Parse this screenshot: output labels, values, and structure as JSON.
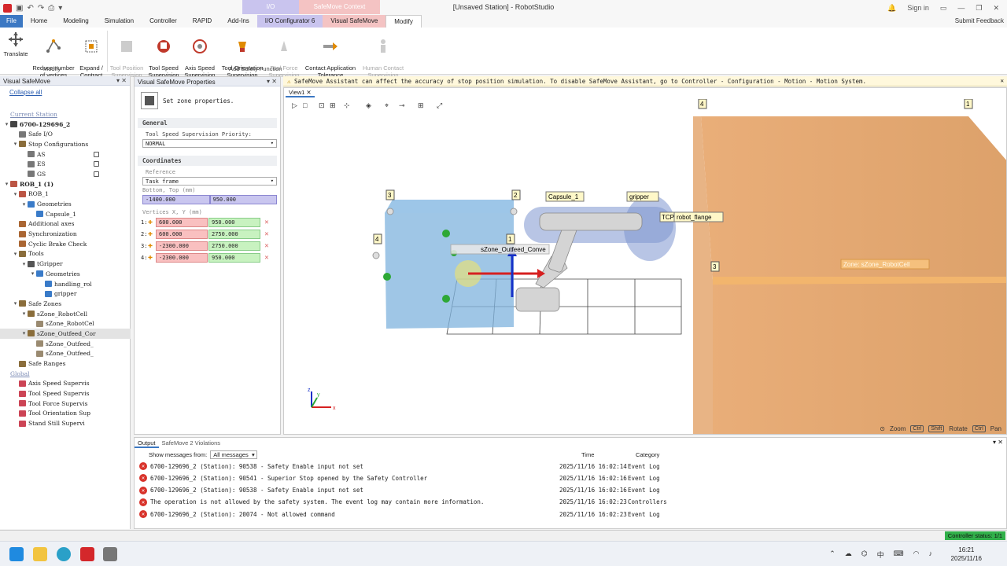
{
  "window": {
    "title": "[Unsaved Station] - RobotStudio",
    "sign_in": "Sign in",
    "context_io": "I/O",
    "context_safemove": "SafeMove Context"
  },
  "tabs": [
    "File",
    "Home",
    "Modeling",
    "Simulation",
    "Controller",
    "RAPID",
    "Add-Ins",
    "I/O Configurator 6",
    "Visual SafeMove",
    "Modify"
  ],
  "submit_feedback": "Submit Feedback",
  "ribbon": {
    "modify_group": {
      "label": "Modify",
      "translate": "Translate",
      "reduce": "Reduce number\nof vertices",
      "expand": "Expand /\nContract"
    },
    "safety_group": {
      "label": "Add Safety Function",
      "tool_position": "Tool Position\nSupervision",
      "tool_speed": "Tool Speed\nSupervision",
      "axis_speed": "Axis Speed\nSupervision",
      "tool_orientation": "Tool Orientation\nSupervision",
      "tool_force": "Tool Force\nSupervision",
      "contact_app": "Contact Application\nTolerance",
      "human_contact": "Human Contact\nSupervision"
    }
  },
  "left_panel": {
    "title": "Visual SafeMove",
    "collapse_all": "Collapse all",
    "tree": [
      {
        "label": "Current Station",
        "level": 0,
        "kind": "section"
      },
      {
        "label": "6700-129696_2",
        "level": 0,
        "kind": "controller",
        "twisty": "▾",
        "bold": true
      },
      {
        "label": "Safe I/O",
        "level": 1,
        "kind": "io"
      },
      {
        "label": "Stop Configurations",
        "level": 1,
        "kind": "folder",
        "twisty": "▾"
      },
      {
        "label": "AS",
        "level": 2,
        "kind": "stop",
        "lock": true
      },
      {
        "label": "ES",
        "level": 2,
        "kind": "stop",
        "lock": true
      },
      {
        "label": "GS",
        "level": 2,
        "kind": "stop",
        "lock": true
      },
      {
        "label": "ROB_1 (1)",
        "level": 0,
        "kind": "robot",
        "twisty": "▾",
        "bold": true
      },
      {
        "label": "ROB_1",
        "level": 1,
        "kind": "robot",
        "twisty": "▾"
      },
      {
        "label": "Geometries",
        "level": 2,
        "kind": "geo",
        "twisty": "▾"
      },
      {
        "label": "Capsule_1",
        "level": 3,
        "kind": "capsule"
      },
      {
        "label": "Additional axes",
        "level": 1,
        "kind": "axes"
      },
      {
        "label": "Synchronization",
        "level": 1,
        "kind": "sync"
      },
      {
        "label": "Cyclic Brake Check",
        "level": 1,
        "kind": "brake"
      },
      {
        "label": "Tools",
        "level": 1,
        "kind": "folder",
        "twisty": "▾"
      },
      {
        "label": "tGripper",
        "level": 2,
        "kind": "tool",
        "twisty": "▾"
      },
      {
        "label": "Geometries",
        "level": 3,
        "kind": "geo",
        "twisty": "▾"
      },
      {
        "label": "handling_rol",
        "level": 4,
        "kind": "capsule"
      },
      {
        "label": "gripper",
        "level": 4,
        "kind": "capsule"
      },
      {
        "label": "Safe Zones",
        "level": 1,
        "kind": "zone",
        "twisty": "▾"
      },
      {
        "label": "sZone_RobotCell",
        "level": 2,
        "kind": "zone",
        "twisty": "▾"
      },
      {
        "label": "sZone_RobotCel",
        "level": 3,
        "kind": "zonefile"
      },
      {
        "label": "sZone_Outfeed_Cor",
        "level": 2,
        "kind": "zone",
        "twisty": "▾",
        "selected": true
      },
      {
        "label": "sZone_Outfeed_",
        "level": 3,
        "kind": "zonefile"
      },
      {
        "label": "sZone_Outfeed_",
        "level": 3,
        "kind": "zonefile"
      },
      {
        "label": "Safe Ranges",
        "level": 1,
        "kind": "range"
      },
      {
        "label": "Global",
        "level": 0,
        "kind": "section"
      },
      {
        "label": "Axis Speed Supervis",
        "level": 1,
        "kind": "sup"
      },
      {
        "label": "Tool Speed Supervis",
        "level": 1,
        "kind": "sup"
      },
      {
        "label": "Tool Force Supervis",
        "level": 1,
        "kind": "sup"
      },
      {
        "label": "Tool Orientation Sup",
        "level": 1,
        "kind": "sup"
      },
      {
        "label": "Stand Still Supervi",
        "level": 1,
        "kind": "sup"
      }
    ]
  },
  "props": {
    "title": "Visual SafeMove Properties",
    "hint": "Set zone properties.",
    "general": "General",
    "priority_label": "Tool Speed Supervision Priority:",
    "priority_value": "NORMAL",
    "coordinates": "Coordinates",
    "reference_label": "Reference",
    "reference_value": "Task frame",
    "bottom_top_label": "Bottom, Top (mm)",
    "bottom": "-1400.000",
    "top": "950.000",
    "vertices_label": "Vertices X, Y (mm)",
    "vertices": [
      {
        "n": "1:",
        "x": "600.000",
        "y": "950.000"
      },
      {
        "n": "2:",
        "x": "600.000",
        "y": "2750.000"
      },
      {
        "n": "3:",
        "x": "-2300.000",
        "y": "2750.000"
      },
      {
        "n": "4:",
        "x": "-2300.000",
        "y": "950.000"
      }
    ]
  },
  "banner": "SafeMove Assistant can affect the accuracy of stop position simulation. To disable SafeMove Assistant, go to Controller - Configuration - Motion - Motion System.",
  "viewport": {
    "tab": "View1",
    "labels": {
      "capsule": "Capsule_1",
      "gripper": "gripper",
      "tcp": "TCP",
      "flange": "robot_flange",
      "zone_cell": "Zone: sZone_RobotCell",
      "zone_outfeed": "sZone_Outfeed_Conve",
      "v1": "1",
      "v2": "2",
      "v3": "3",
      "v4": "4",
      "axis_x": "x",
      "axis_y": "y",
      "axis_z": "z"
    },
    "hints": {
      "zoom": "Zoom",
      "rotate": "Rotate",
      "pan": "Pan",
      "ctrl": "Ctrl",
      "shift": "Shift"
    }
  },
  "output": {
    "tab_output": "Output",
    "tab_violations": "SafeMove 2 Violations",
    "filter_label": "Show messages from:",
    "filter_value": "All messages",
    "col_time": "Time",
    "col_category": "Category",
    "rows": [
      {
        "msg": "6700-129696_2 (Station): 90538 - Safety Enable input not set",
        "time": "2025/11/16 16:02:14",
        "cat": "Event Log"
      },
      {
        "msg": "6700-129696_2 (Station): 90541 - Superior Stop opened by the Safety Controller",
        "time": "2025/11/16 16:02:16",
        "cat": "Event Log"
      },
      {
        "msg": "6700-129696_2 (Station): 90538 - Safety Enable input not set",
        "time": "2025/11/16 16:02:16",
        "cat": "Event Log"
      },
      {
        "msg": "The operation is not allowed by the safety system. The event log may contain more information.",
        "time": "2025/11/16 16:02:23",
        "cat": "Controllers"
      },
      {
        "msg": "6700-129696_2 (Station): 20074 - Not allowed command",
        "time": "2025/11/16 16:02:23",
        "cat": "Event Log"
      }
    ]
  },
  "status": {
    "controller": "Controller status: 1/1"
  },
  "taskbar": {
    "time": "16:21",
    "date": "2025/11/16",
    "ime": "中"
  },
  "colors": {
    "accent": "#3c78c3",
    "error": "#d8322a",
    "status_ok": "#31b04a",
    "zone_fill": "#f0a868"
  }
}
